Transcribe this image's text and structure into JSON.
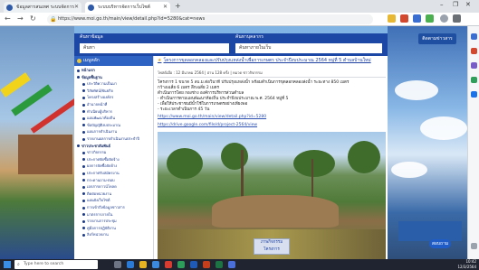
{
  "browser": {
    "tabs": [
      {
        "label": "ข้อมูลสารสนเทศ ระบบจัดการ"
      },
      {
        "label": "ระบบบริหารจัดการเว็บไซต์"
      }
    ],
    "new_tab": "+",
    "window_controls": [
      "–",
      "❐",
      "✕"
    ],
    "url": "https://www.moi.go.th/main/view/detail.php?id=5280&cat=news",
    "nav": {
      "back": "←",
      "forward": "→",
      "reload": "↻"
    }
  },
  "site": {
    "search_label_left": "ค้นหาข้อมูล",
    "search_label_right": "ค้นหาบุคลากร",
    "search_value_left": "ค้นหา",
    "search_value_right": "ค้นหาภายในเว็บ",
    "facebook_button": "ติดตามข่าวสาร",
    "chat_button": "สอบถาม"
  },
  "sidebar": {
    "heading": "เมนูหลัก",
    "items": [
      {
        "label": "หน้าแรก",
        "group": true
      },
      {
        "label": "ข้อมูลพื้นฐาน",
        "group": true
      },
      {
        "label": "ประวัติความเป็นมา",
        "group": false
      },
      {
        "label": "วิสัยทัศน์/พันธกิจ",
        "group": false
      },
      {
        "label": "โครงสร้างองค์กร",
        "group": false
      },
      {
        "label": "อำนาจหน้าที่",
        "group": false
      },
      {
        "label": "ทำเนียบผู้บริหาร",
        "group": false
      },
      {
        "label": "แผนพัฒนาท้องถิ่น",
        "group": false
      },
      {
        "label": "ข้อบัญญัติงบประมาณ",
        "group": false
      },
      {
        "label": "แผนการดำเนินงาน",
        "group": false
      },
      {
        "label": "รายงานผลการดำเนินงานประจำปี",
        "group": false
      },
      {
        "label": "ข่าวประชาสัมพันธ์",
        "group": true
      },
      {
        "label": "ข่าวกิจกรรม",
        "group": false
      },
      {
        "label": "ประกาศจัดซื้อจัดจ้าง",
        "group": false
      },
      {
        "label": "ผลการจัดซื้อจัดจ้าง",
        "group": false
      },
      {
        "label": "ประกาศรับสมัครงาน",
        "group": false
      },
      {
        "label": "กระดานถาม-ตอบ",
        "group": false
      },
      {
        "label": "เอกสารดาวน์โหลด",
        "group": false
      },
      {
        "label": "ติดต่อหน่วยงาน",
        "group": false
      },
      {
        "label": "แผนผังเว็บไซต์",
        "group": false
      },
      {
        "label": "การเข้าถึงข้อมูลข่าวสาร",
        "group": false
      },
      {
        "label": "มาตรการภายใน",
        "group": false
      },
      {
        "label": "รายงานการประชุม",
        "group": false
      },
      {
        "label": "คู่มือการปฏิบัติงาน",
        "group": false
      },
      {
        "label": "ลิงก์หน่วยงาน",
        "group": false
      }
    ]
  },
  "article": {
    "title": "โครงการขุดลอกคลองและปรับปรุงแหล่งน้ำเพื่อการเกษตร ประจำปีงบประมาณ 2564 หมู่ที่ 5 ตำบลบ้านใหม่",
    "meta": "โพสต์เมื่อ : 12 มีนาคม 2564 | อ่าน 128 ครั้ง | หมวด ข่าวกิจกรรม",
    "lines": [
      "โครงการ 1 ขนาด 5 ลบ.ม.ต่อวินาที ปรับปรุงแหล่งน้ำ พร้อมดำเนินการขุดลอกคลองส่งน้ำ ระยะทาง 850 เมตร",
      "กว้างเฉลี่ย 6 เมตร ลึกเฉลี่ย 2 เมตร",
      "ดำเนินการโดย กองช่าง องค์การบริหารส่วนตำบล",
      "- ดำเนินการตามแผนพัฒนาท้องถิ่น ประจำปีงบประมาณ พ.ศ. 2564 หมู่ที่ 5",
      "- เพื่อให้ประชาชนมีน้ำใช้ในการเกษตรอย่างเพียงพอ",
      "- ระยะเวลาดำเนินการ 45 วัน"
    ],
    "link_label": "https://www.moi.go.th/main/view/detail.php?id=5280",
    "link_label_2": "https://drive.google.com/file/d/project-2564/view",
    "photo_caption": "ภาพกิจกรรม โครงการ"
  },
  "taskbar": {
    "search_placeholder": "Type here to search",
    "time": "10:42",
    "date": "12/3/2564"
  },
  "colors": {
    "site_blue": "#1d47a5",
    "sidebar_head": "#2e63c4",
    "link": "#1d3fa0"
  }
}
